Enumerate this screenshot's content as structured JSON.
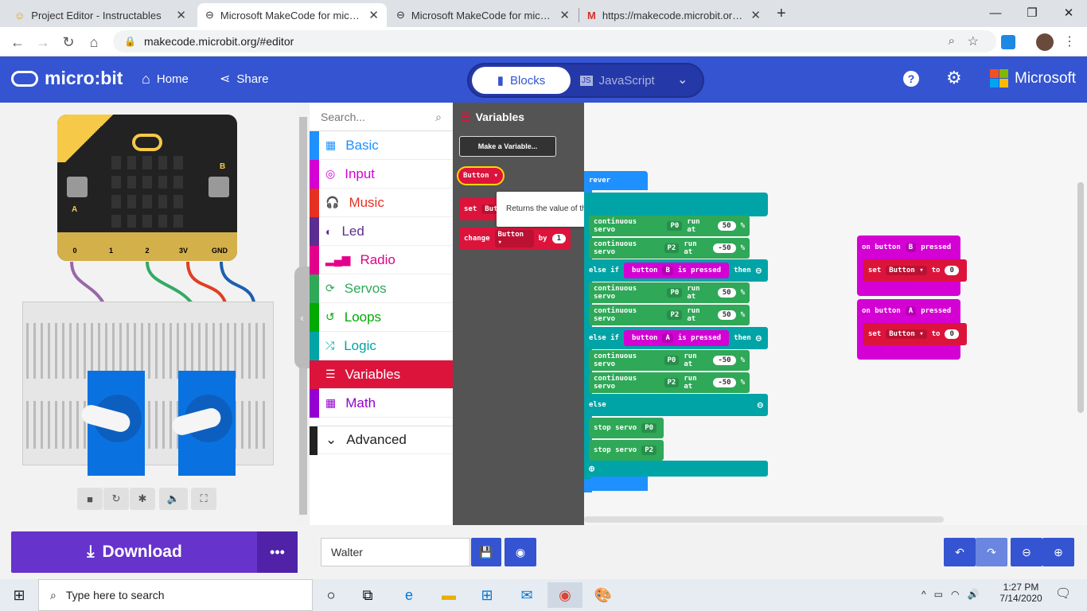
{
  "browser": {
    "tabs": [
      {
        "title": "Project Editor - Instructables",
        "active": false
      },
      {
        "title": "Microsoft MakeCode for micro:bit",
        "active": true
      },
      {
        "title": "Microsoft MakeCode for micro:bit",
        "active": false
      },
      {
        "title": "https://makecode.microbit.org/_l",
        "active": false
      }
    ],
    "url": "makecode.microbit.org/#editor"
  },
  "header": {
    "logo": "micro:bit",
    "home": "Home",
    "share": "Share",
    "blocks": "Blocks",
    "javascript": "JavaScript",
    "microsoft": "Microsoft"
  },
  "simulator": {
    "pins": [
      "0",
      "1",
      "2",
      "3V",
      "GND"
    ],
    "button_a": "A",
    "button_b": "B"
  },
  "toolbox": {
    "search_placeholder": "Search...",
    "categories": [
      {
        "label": "Basic",
        "color": "#1e90ff",
        "icon": "grid-icon"
      },
      {
        "label": "Input",
        "color": "#d400d4",
        "icon": "target-icon"
      },
      {
        "label": "Music",
        "color": "#e63022",
        "icon": "headphones-icon"
      },
      {
        "label": "Led",
        "color": "#5c2d91",
        "icon": "toggle-icon"
      },
      {
        "label": "Radio",
        "color": "#e3008c",
        "icon": "signal-icon"
      },
      {
        "label": "Servos",
        "color": "#2fa858",
        "icon": "refresh-icon"
      },
      {
        "label": "Loops",
        "color": "#00aa00",
        "icon": "loop-icon"
      },
      {
        "label": "Logic",
        "color": "#00a4a6",
        "icon": "shuffle-icon"
      },
      {
        "label": "Variables",
        "color": "#dc143c",
        "icon": "list-icon"
      },
      {
        "label": "Math",
        "color": "#9400d3",
        "icon": "calculator-icon"
      }
    ],
    "advanced": "Advanced"
  },
  "flyout": {
    "title": "Variables",
    "make_variable": "Make a Variable...",
    "var_name": "Button",
    "set_label": "set",
    "set_partial": "But",
    "change_label": "change",
    "by_label": "by",
    "by_value": "1",
    "tooltip": "Returns the value of this variable."
  },
  "workspace": {
    "forever": "rever",
    "continuous_servo": "continuous servo",
    "run_at": "run at",
    "percent": "%",
    "pin_p0": "P0",
    "pin_p2": "P2",
    "else_if": "else if",
    "else": "else",
    "then": "then",
    "button_label": "button",
    "is_pressed": "is pressed",
    "stop_servo": "stop servo",
    "rows": [
      {
        "pin": "P0",
        "val": "50"
      },
      {
        "pin": "P2",
        "val": "-50"
      },
      {
        "pin": "P0",
        "val": "50"
      },
      {
        "pin": "P2",
        "val": "50"
      },
      {
        "pin": "P0",
        "val": "-50"
      },
      {
        "pin": "P2",
        "val": "-50"
      }
    ],
    "cond1_button": "B",
    "cond2_button": "A",
    "on_button": "on button",
    "pressed": "pressed",
    "event_b": "B",
    "event_a": "A",
    "set": "set",
    "to": "to",
    "var": "Button",
    "zero": "0"
  },
  "bottom": {
    "download": "Download",
    "more": "•••",
    "project_name": "Walter"
  },
  "taskbar": {
    "search": "Type here to search",
    "time": "1:27 PM",
    "date": "7/14/2020"
  }
}
